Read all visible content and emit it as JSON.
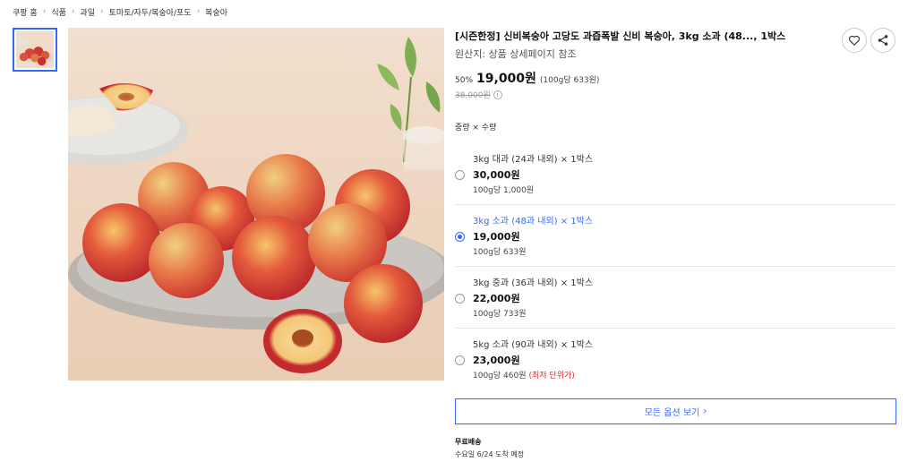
{
  "breadcrumb": [
    {
      "label": "쿠팡 홈"
    },
    {
      "label": "식품"
    },
    {
      "label": "과일"
    },
    {
      "label": "토마토/자두/복숭아/포도"
    },
    {
      "label": "복숭아"
    }
  ],
  "product": {
    "title": "[시즌한정] 신비복숭아 고당도 과즙폭발 신비 복숭아, 3kg 소과 (48..., 1박스",
    "origin": "원산지: 상품 상세페이지 참조",
    "discount": "50%",
    "sale_price": "19,000원",
    "unit_price": "(100g당 633원)",
    "original_price": "38,000원",
    "info_icon": "i"
  },
  "icons": {
    "heart": "heart-icon",
    "share": "share-icon",
    "chevron": "chevron-right-icon"
  },
  "options": {
    "heading": "중량 × 수량",
    "items": [
      {
        "name": "3kg 대과 (24과 내외) × 1박스",
        "price": "30,000원",
        "unit": "100g당 1,000원",
        "selected": false,
        "note": ""
      },
      {
        "name": "3kg 소과 (48과 내외) × 1박스",
        "price": "19,000원",
        "unit": "100g당 633원",
        "selected": true,
        "note": ""
      },
      {
        "name": "3kg 중과 (36과 내외) × 1박스",
        "price": "22,000원",
        "unit": "100g당 733원",
        "selected": false,
        "note": ""
      },
      {
        "name": "5kg 소과 (90과 내외) × 1박스",
        "price": "23,000원",
        "unit": "100g당 460원",
        "selected": false,
        "note": "(최저 단위가)"
      }
    ],
    "all_button": "모든 옵션 보기",
    "all_button_arrow": "›"
  },
  "shipping": {
    "label": "무료배송",
    "date": "수요일 6/24 도착 예정"
  },
  "colors": {
    "accent": "#346aff",
    "lowest_price": "#e52528"
  }
}
